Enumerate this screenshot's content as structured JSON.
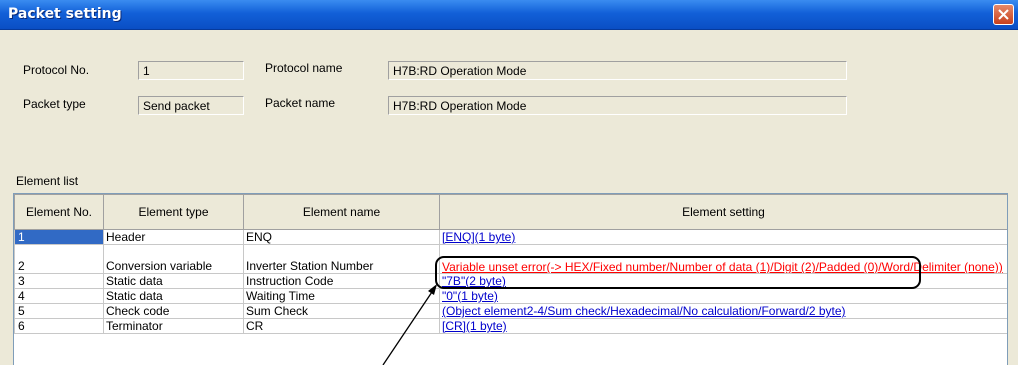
{
  "window": {
    "title": "Packet setting"
  },
  "fields": {
    "protocol_no_label": "Protocol No.",
    "protocol_no": "1",
    "protocol_name_label": "Protocol name",
    "protocol_name": "H7B:RD Operation Mode",
    "packet_type_label": "Packet type",
    "packet_type": "Send packet",
    "packet_name_label": "Packet name",
    "packet_name": "H7B:RD Operation Mode"
  },
  "element_list": {
    "label": "Element list",
    "headers": {
      "no": "Element No.",
      "type": "Element type",
      "name": "Element name",
      "setting": "Element setting"
    },
    "rows": [
      {
        "no": "1",
        "type": "Header",
        "name": "ENQ",
        "setting": "[ENQ](1 byte)"
      },
      {
        "no": "2",
        "type": "Conversion variable",
        "name": "Inverter Station Number",
        "setting": "Variable unset error(-> HEX/Fixed number/Number of data (1)/Digit (2)/Padded (0)/Word/Delimiter (none))"
      },
      {
        "no": "3",
        "type": "Static data",
        "name": "Instruction Code",
        "setting": "\"7B\"(2 byte)"
      },
      {
        "no": "4",
        "type": "Static data",
        "name": "Waiting Time",
        "setting": "\"0\"(1 byte)"
      },
      {
        "no": "5",
        "type": "Check code",
        "name": "Sum Check",
        "setting": "(Object element2-4/Sum check/Hexadecimal/No calculation/Forward/2 byte)"
      },
      {
        "no": "6",
        "type": "Terminator",
        "name": "CR",
        "setting": "[CR](1 byte)"
      }
    ]
  },
  "colors": {
    "titlebar": "#0a4ec4",
    "selection": "#316ac5",
    "error": "#ff0000",
    "link": "#0000cc"
  }
}
